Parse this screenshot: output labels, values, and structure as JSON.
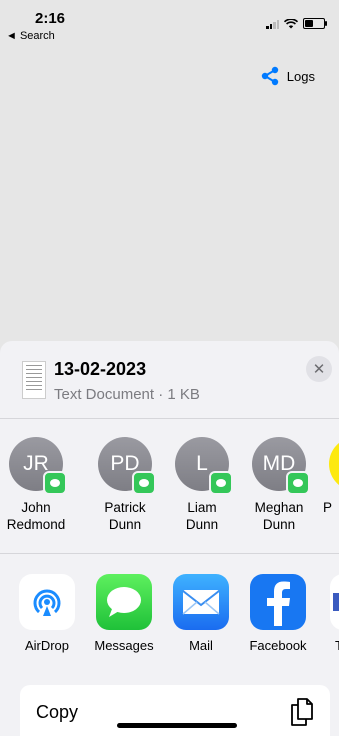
{
  "status": {
    "time": "2:16",
    "back_label": "◄ Search",
    "battery_level": 0.45
  },
  "logs": {
    "label": "Logs",
    "icon": "share-icon",
    "color": "#007aff"
  },
  "file": {
    "title": "13-02-2023",
    "subtitle": "Text Document · 1 KB",
    "close_symbol": "✕"
  },
  "contacts": [
    {
      "initials": "JR",
      "name_line1": "John",
      "name_line2": "Redmond"
    },
    {
      "initials": "PD",
      "name_line1": "Patrick",
      "name_line2": "Dunn"
    },
    {
      "initials": "L",
      "name_line1": "Liam",
      "name_line2": "Dunn"
    },
    {
      "initials": "MD",
      "name_line1": "Meghan",
      "name_line2": "Dunn"
    },
    {
      "initials": "",
      "name_line1": "P",
      "name_line2": ""
    }
  ],
  "apps": [
    {
      "label": "AirDrop",
      "icon": "airdrop-icon"
    },
    {
      "label": "Messages",
      "icon": "messages-icon"
    },
    {
      "label": "Mail",
      "icon": "mail-icon"
    },
    {
      "label": "Facebook",
      "icon": "facebook-icon"
    },
    {
      "label": "T",
      "icon": "app-icon"
    }
  ],
  "copy": {
    "label": "Copy",
    "icon": "copy-icon"
  }
}
